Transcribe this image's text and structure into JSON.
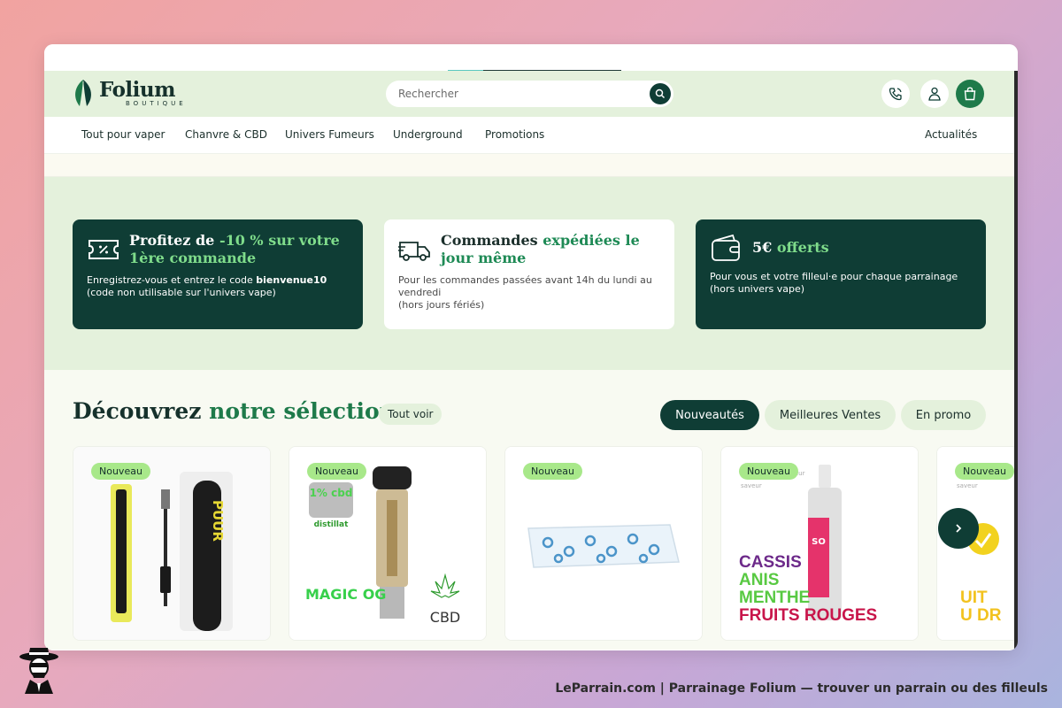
{
  "brand": {
    "name": "Folium",
    "sub": "BOUTIQUE"
  },
  "search": {
    "placeholder": "Rechercher"
  },
  "header_icons": [
    "phone-icon",
    "user-icon",
    "cart-icon"
  ],
  "nav": {
    "items": [
      "Tout pour vaper",
      "Chanvre & CBD",
      "Univers Fumeurs",
      "Underground",
      "Promotions"
    ],
    "right": "Actualités"
  },
  "promos": [
    {
      "title_a": "Profitez de ",
      "title_hl": "-10 % sur votre 1ère commande",
      "body_a": "Enregistrez-vous et entrez le code ",
      "body_code": "bienvenue10",
      "body_b": "(code non utilisable sur l'univers vape)"
    },
    {
      "title_a": "Commandes ",
      "title_hl": "expédiées le jour même",
      "body": "Pour les commandes passées avant 14h du lundi au vendredi",
      "body_b": "(hors jours fériés)"
    },
    {
      "title_a": "5€ ",
      "title_hl": "offerts",
      "body": "Pour vous et votre filleul·e pour chaque parrainage",
      "body_b": "(hors univers vape)"
    }
  ],
  "selection": {
    "title_a": "Découvrez ",
    "title_hl": "notre sélection",
    "see_all": "Tout voir",
    "tabs": [
      "Nouveautés",
      "Meilleures Ventes",
      "En promo"
    ]
  },
  "products": [
    {
      "badge": "Nouveau",
      "label": "PUUR"
    },
    {
      "badge": "Nouveau",
      "label": "MAGIC OG",
      "tag": "1% cbd",
      "tag2": "distillat",
      "mark": "CBD"
    },
    {
      "badge": "Nouveau"
    },
    {
      "badge": "Nouveau",
      "lines": [
        "CASSIS",
        "ANIS",
        "MENTHE",
        "FRUITS ROUGES"
      ],
      "small_a": "saveur",
      "small_b": "vapeur",
      "can": "SO"
    },
    {
      "badge": "Nouveau",
      "small": "saveur",
      "partial": [
        "UIT",
        "U DR"
      ]
    }
  ],
  "credit": "LeParrain.com | Parrainage Folium — trouver un parrain ou des filleuls",
  "colors": {
    "dark_green": "#0f3d35",
    "accent_green": "#7fdc8b",
    "light_band": "#e4f1dc",
    "badge": "#a8e88a"
  }
}
